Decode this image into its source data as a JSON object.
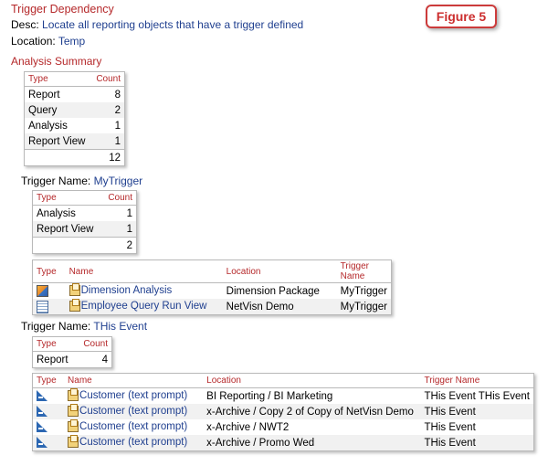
{
  "header": {
    "title": "Trigger Dependency",
    "desc_label": "Desc:",
    "desc_value": "Locate all reporting objects that have a trigger defined",
    "location_label": "Location:",
    "location_value": "Temp",
    "figure_label": "Figure 5"
  },
  "summary": {
    "heading": "Analysis Summary",
    "columns": [
      "Type",
      "Count"
    ],
    "rows": [
      {
        "type": "Report",
        "count": "8"
      },
      {
        "type": "Query",
        "count": "2"
      },
      {
        "type": "Analysis",
        "count": "1"
      },
      {
        "type": "Report View",
        "count": "1"
      }
    ],
    "total": "12"
  },
  "trigger1": {
    "label": "Trigger Name:",
    "name": "MyTrigger",
    "count_columns": [
      "Type",
      "Count"
    ],
    "count_rows": [
      {
        "type": "Analysis",
        "count": "1"
      },
      {
        "type": "Report View",
        "count": "1"
      }
    ],
    "total": "2",
    "detail_columns": [
      "Type",
      "Name",
      "Location",
      "Trigger Name"
    ],
    "detail_rows": [
      {
        "icon": "cube-icon",
        "name": "Dimension Analysis",
        "location": "Dimension Package",
        "trigger": "MyTrigger"
      },
      {
        "icon": "report-view-icon",
        "name": "Employee Query Run View",
        "location": "NetVisn Demo",
        "trigger": "MyTrigger"
      }
    ]
  },
  "trigger2": {
    "label": "Trigger Name:",
    "name": "THis Event",
    "count_columns": [
      "Type",
      "Count"
    ],
    "count_rows": [
      {
        "type": "Report",
        "count": "4"
      }
    ],
    "detail_columns": [
      "Type",
      "Name",
      "Location",
      "Trigger Name"
    ],
    "detail_rows": [
      {
        "icon": "report-triangle-icon",
        "name": "Customer (text prompt)",
        "location": "BI Reporting / BI Marketing",
        "trigger": "THis Event THis Event"
      },
      {
        "icon": "report-triangle-icon",
        "name": "Customer (text prompt)",
        "location": "x-Archive / Copy 2 of Copy of NetVisn Demo",
        "trigger": "THis Event"
      },
      {
        "icon": "report-triangle-icon",
        "name": "Customer (text prompt)",
        "location": "x-Archive / NWT2",
        "trigger": "THis Event"
      },
      {
        "icon": "report-triangle-icon",
        "name": "Customer (text prompt)",
        "location": "x-Archive / Promo Wed",
        "trigger": "THis Event"
      }
    ]
  }
}
